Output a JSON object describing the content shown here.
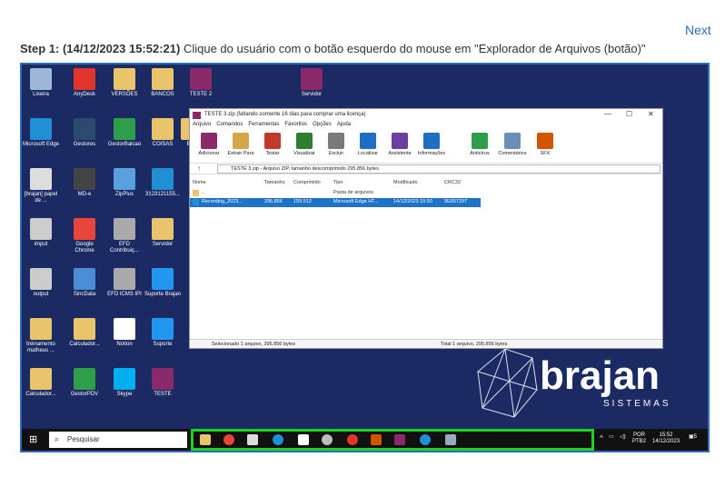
{
  "nav": {
    "next_label": "Next"
  },
  "step": {
    "title": "Step 1: (14/12/2023 15:52:21)",
    "text": " Clique do usuário com o botão esquerdo do mouse em \"Explorador de Arquivos (botão)\""
  },
  "desktop_icons": [
    {
      "label": "Lixeira",
      "color": "#9bb8d8"
    },
    {
      "label": "AnyDesk",
      "color": "#e0352b"
    },
    {
      "label": "VERSÕES",
      "color": "#e9c46a"
    },
    {
      "label": "BANCOS",
      "color": "#e9c46a"
    },
    {
      "label": "TESTE 2",
      "color": "#8b2a6b"
    },
    {
      "label": "Servidor",
      "color": "#8b2a6b"
    },
    {
      "label": "Microsoft Edge",
      "color": "#1f8fd6"
    },
    {
      "label": "Gestores",
      "color": "#2a4a6e"
    },
    {
      "label": "GestorBalcao",
      "color": "#2e9e4a"
    },
    {
      "label": "COISAS",
      "color": "#e9c46a"
    },
    {
      "label": "Ban",
      "color": "#e9c46a"
    },
    {
      "label": "MD-e",
      "color": "#444"
    },
    {
      "label": "ZipPlus",
      "color": "#5aa0e0"
    },
    {
      "label": "3123121155...",
      "color": "#1f8fd6"
    },
    {
      "label": "[brajan] papel de ...",
      "color": "#ddd"
    },
    {
      "label": "imput",
      "color": "#ccc"
    },
    {
      "label": "Google Chrome",
      "color": "#e8453c"
    },
    {
      "label": "EFD Contribuiç...",
      "color": "#aaa"
    },
    {
      "label": "Servidor",
      "color": "#e9c46a"
    },
    {
      "label": "output",
      "color": "#ccc"
    },
    {
      "label": "SincData",
      "color": "#4a8cd6"
    },
    {
      "label": "EFD ICMS IPI",
      "color": "#aaa"
    },
    {
      "label": "Suporte Brajan",
      "color": "#2196f3"
    },
    {
      "label": "treinamento matheus ...",
      "color": "#e9c46a"
    },
    {
      "label": "Calculador...",
      "color": "#e9c46a"
    },
    {
      "label": "Notion",
      "color": "#fff"
    },
    {
      "label": "Suporte",
      "color": "#2196f3"
    },
    {
      "label": "Calculador...",
      "color": "#e9c46a"
    },
    {
      "label": "GestorPDV",
      "color": "#2e9e4a"
    },
    {
      "label": "Skype",
      "color": "#00aff0"
    },
    {
      "label": "TESTE",
      "color": "#8b2a6b"
    }
  ],
  "window": {
    "title": "TESTE 3.zip (faltando somente 16 dias para comprar uma licença)",
    "menu": [
      "Arquivo",
      "Comandos",
      "Ferramentas",
      "Favoritos",
      "Opções",
      "Ajuda"
    ],
    "toolbar": [
      {
        "label": "Adicionar",
        "color": "#8b2a6b"
      },
      {
        "label": "Extrair Para",
        "color": "#d6a54a"
      },
      {
        "label": "Testar",
        "color": "#c0392b"
      },
      {
        "label": "Visualizar",
        "color": "#2e7d32"
      },
      {
        "label": "Excluir",
        "color": "#7a7a7a"
      },
      {
        "label": "Localizar",
        "color": "#1e6fc4"
      },
      {
        "label": "Assistente",
        "color": "#6a3fa0"
      },
      {
        "label": "Informações",
        "color": "#1e6fc4"
      },
      {
        "label": "Antivírus",
        "color": "#2e9e4a"
      },
      {
        "label": "Comentários",
        "color": "#6b8fb5"
      },
      {
        "label": "SFX",
        "color": "#d35400"
      }
    ],
    "address": "TESTE 3.zip - Arquivo ZIP, tamanho descomprimido 295.856 bytes",
    "columns": [
      "Nome",
      "Tamanho",
      "Comprimido",
      "Tipo",
      "Modificado",
      "CRC32"
    ],
    "rows": [
      {
        "name": "..",
        "size": "",
        "compressed": "",
        "type": "Pasta de arquivos",
        "modified": "",
        "crc": ""
      },
      {
        "name": "Recording_2023...",
        "size": "295.856",
        "compressed": "159.512",
        "type": "Microsoft Edge HT...",
        "modified": "14/12/2023 15:50",
        "crc": "5E657297"
      }
    ],
    "status_left": "Selecionado 1 arquivo, 295.856 bytes",
    "status_right": "Total 1 arquivo, 295.856 bytes"
  },
  "brand": {
    "name": "brajan",
    "subtitle": "SISTEMAS"
  },
  "taskbar": {
    "search_placeholder": "Pesquisar",
    "tray": {
      "lang": "POR",
      "layout": "PTB2",
      "time": "15:52",
      "date": "14/12/2023",
      "notif": "5"
    }
  }
}
